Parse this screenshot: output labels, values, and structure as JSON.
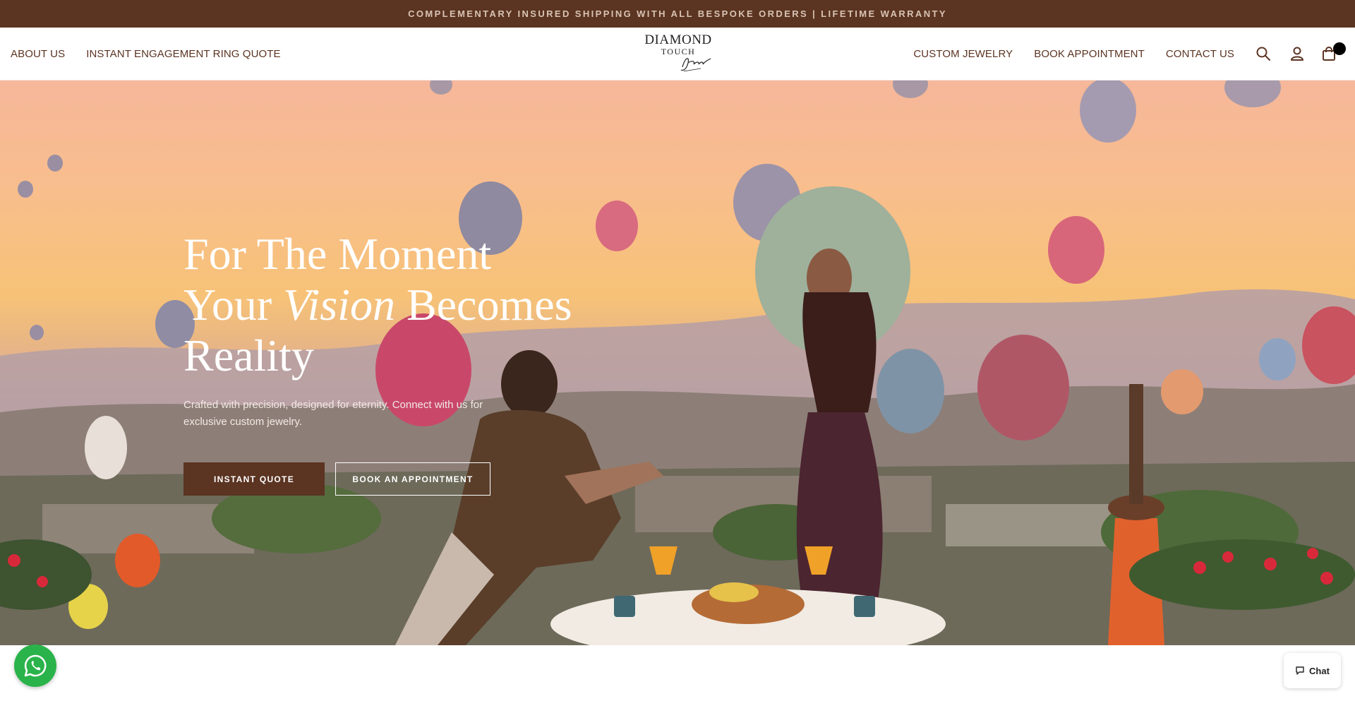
{
  "announcement": {
    "text": "COMPLEMENTARY INSURED SHIPPING WITH ALL BESPOKE ORDERS | LIFETIME WARRANTY"
  },
  "header": {
    "left_nav": [
      {
        "label": "ABOUT US"
      },
      {
        "label": "INSTANT ENGAGEMENT RING QUOTE"
      }
    ],
    "logo": {
      "line1": "DIAMOND",
      "line2": "TOUCH",
      "signature": "Jewels"
    },
    "right_nav": [
      {
        "label": "CUSTOM JEWELRY"
      },
      {
        "label": "BOOK APPOINTMENT"
      },
      {
        "label": "CONTACT US"
      }
    ],
    "icons": [
      "search-icon",
      "account-icon",
      "cart-icon"
    ]
  },
  "hero": {
    "title_line1": "For The Moment",
    "title_line2_a": "Your ",
    "title_line2_em": "Vision",
    "title_line2_b": " Becomes",
    "title_line3": "Reality",
    "subtitle": "Crafted with precision, designed for eternity. Connect with us for exclusive custom jewelry.",
    "primary_button": "INSTANT QUOTE",
    "secondary_button": "BOOK AN APPOINTMENT"
  },
  "widgets": {
    "chat_label": "Chat",
    "whatsapp_icon": "whatsapp-icon"
  },
  "colors": {
    "brand_brown": "#5b3422",
    "whatsapp_green": "#2ab34a"
  }
}
